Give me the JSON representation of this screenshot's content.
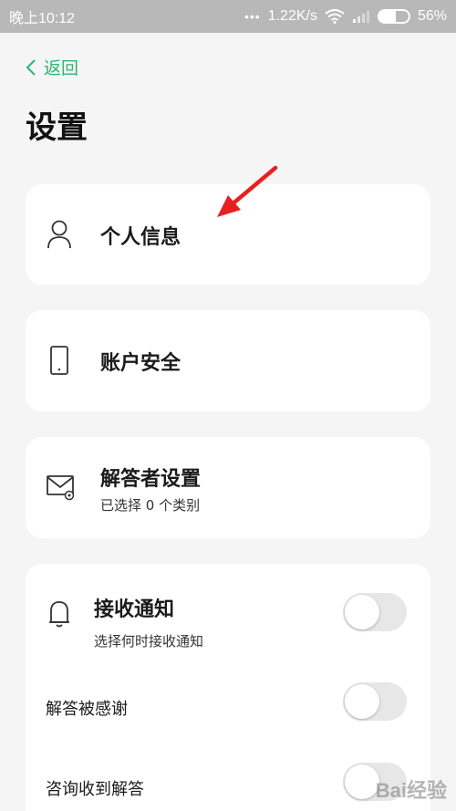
{
  "status_bar": {
    "time": "晚上10:12",
    "dots": "•••",
    "network_speed": "1.22K/s",
    "battery_percent": "56%",
    "battery_level": 0.56
  },
  "nav": {
    "back_label": "返回"
  },
  "page": {
    "title": "设置"
  },
  "cards": {
    "personal_info": {
      "label": "个人信息",
      "icon": "person-icon"
    },
    "account_security": {
      "label": "账户安全",
      "icon": "phone-icon"
    },
    "answerer_settings": {
      "label": "解答者设置",
      "subtitle": "已选择 0 个类别",
      "icon": "mail-settings-icon"
    },
    "notifications": {
      "label": "接收通知",
      "subtitle": "选择何时接收通知",
      "icon": "bell-icon",
      "rows": [
        {
          "label": "解答被感谢",
          "enabled": false
        },
        {
          "label": "咨询收到解答",
          "enabled": false
        }
      ],
      "enabled": false
    }
  },
  "watermark": "Bai经验",
  "colors": {
    "accent": "#2bb673",
    "annotation_arrow": "#e8201f"
  }
}
